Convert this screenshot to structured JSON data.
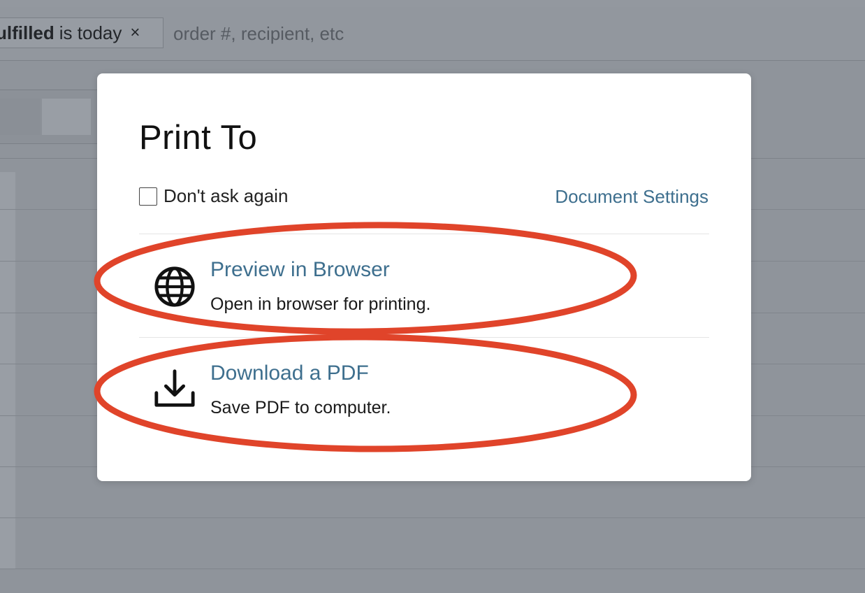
{
  "filter": {
    "field": "ulfilled",
    "rest": "is today",
    "close_glyph": "×"
  },
  "search": {
    "placeholder": "order #, recipient, etc"
  },
  "dialog": {
    "title": "Print To",
    "dont_ask_label": "Don't ask again",
    "dont_ask_checked": false,
    "document_settings": "Document Settings",
    "options": [
      {
        "icon": "globe-icon",
        "title": "Preview in Browser",
        "description": "Open in browser for printing."
      },
      {
        "icon": "download-icon",
        "title": "Download a PDF",
        "description": "Save PDF to computer."
      }
    ]
  },
  "colors": {
    "link": "#3e6f8e",
    "annotation": "#e0442a",
    "overlay": "#8f949b"
  }
}
